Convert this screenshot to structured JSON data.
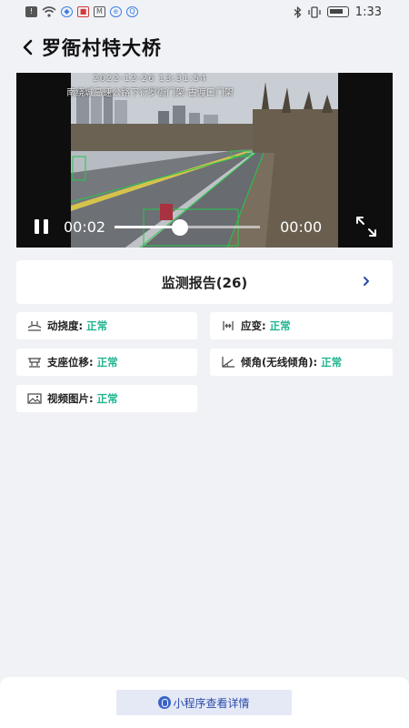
{
  "status_bar": {
    "time": "1:33",
    "left_icons": [
      "alert-icon",
      "wifi-icon",
      "shield-icon",
      "mail-icon",
      "vpn-icon",
      "browser-icon",
      "qq-icon"
    ],
    "right_icons": [
      "bluetooth-icon",
      "vibrate-icon",
      "battery-icon"
    ]
  },
  "header": {
    "title": "罗衙村特大桥"
  },
  "video": {
    "timestamp": "2022-12-26 13:31:54",
    "location": "南绕城高速公路下行罗衙门架-古渡口门架",
    "current_time": "00:02",
    "total_time": "00:00",
    "progress": 0.45,
    "state": "paused-control-shown"
  },
  "report": {
    "label": "监测报告(26)"
  },
  "indicators": [
    {
      "icon": "dynamic-deflection-icon",
      "label": "动挠度:",
      "status": "正常"
    },
    {
      "icon": "strain-icon",
      "label": "应变:",
      "status": "正常"
    },
    {
      "icon": "bearing-displacement-icon",
      "label": "支座位移:",
      "status": "正常"
    },
    {
      "icon": "tilt-icon",
      "label": "倾角(无线倾角):",
      "status": "正常"
    },
    {
      "icon": "video-image-icon",
      "label": "视频图片:",
      "status": "正常"
    }
  ],
  "bottom": {
    "mini_program_label": "小程序查看详情"
  },
  "colors": {
    "status_ok": "#21b58f",
    "page_bg": "#f1f2f6",
    "button_bg": "#e5e9f6",
    "button_text": "#2a4aa8"
  }
}
